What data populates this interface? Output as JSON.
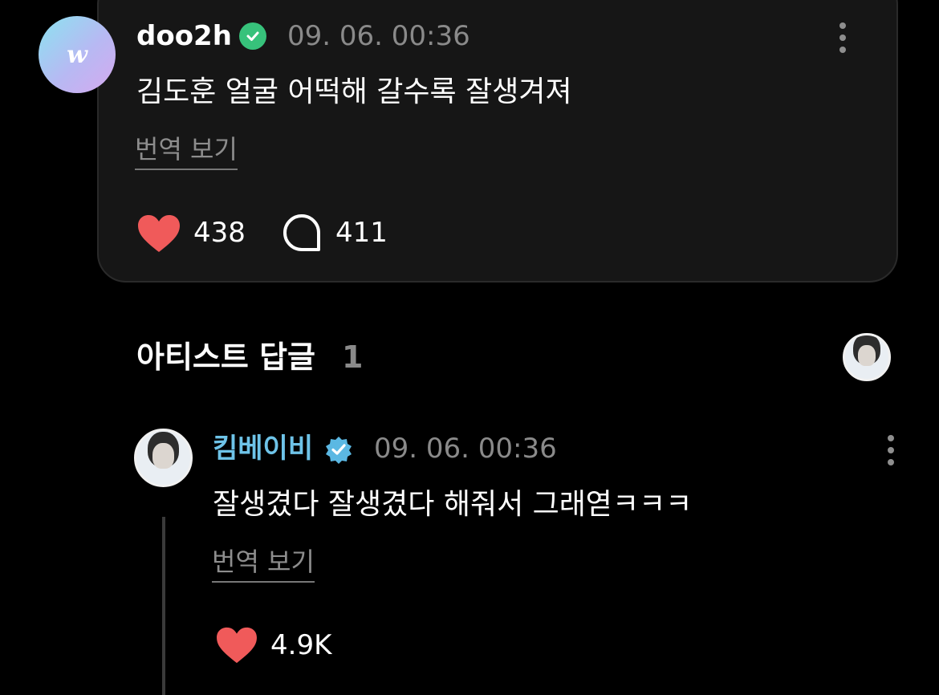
{
  "fan_comment": {
    "username": "doo2h",
    "avatar_letter": "w",
    "timestamp": "09. 06. 00:36",
    "text": "김도훈 얼굴 어떡해 갈수록 잘생겨져",
    "translate_label": "번역 보기",
    "likes": "438",
    "replies": "411"
  },
  "artist_section": {
    "title": "아티스트 답글",
    "count": "1"
  },
  "artist_reply": {
    "username": "킴베이비",
    "timestamp": "09. 06. 00:36",
    "text": "잘생겼다 잘생겼다 해줘서 그래엳ㅋㅋㅋ",
    "translate_label": "번역 보기",
    "likes": "4.9K"
  },
  "colors": {
    "background": "#000000",
    "card": "#161616",
    "heart": "#f05a5a",
    "artist_name": "#6ec3e8",
    "verified_green": "#37c27b",
    "verified_blue": "#5bb8e3"
  },
  "icons": [
    "verified-green-icon",
    "more-icon",
    "heart-icon",
    "comment-icon",
    "verified-blue-icon"
  ]
}
